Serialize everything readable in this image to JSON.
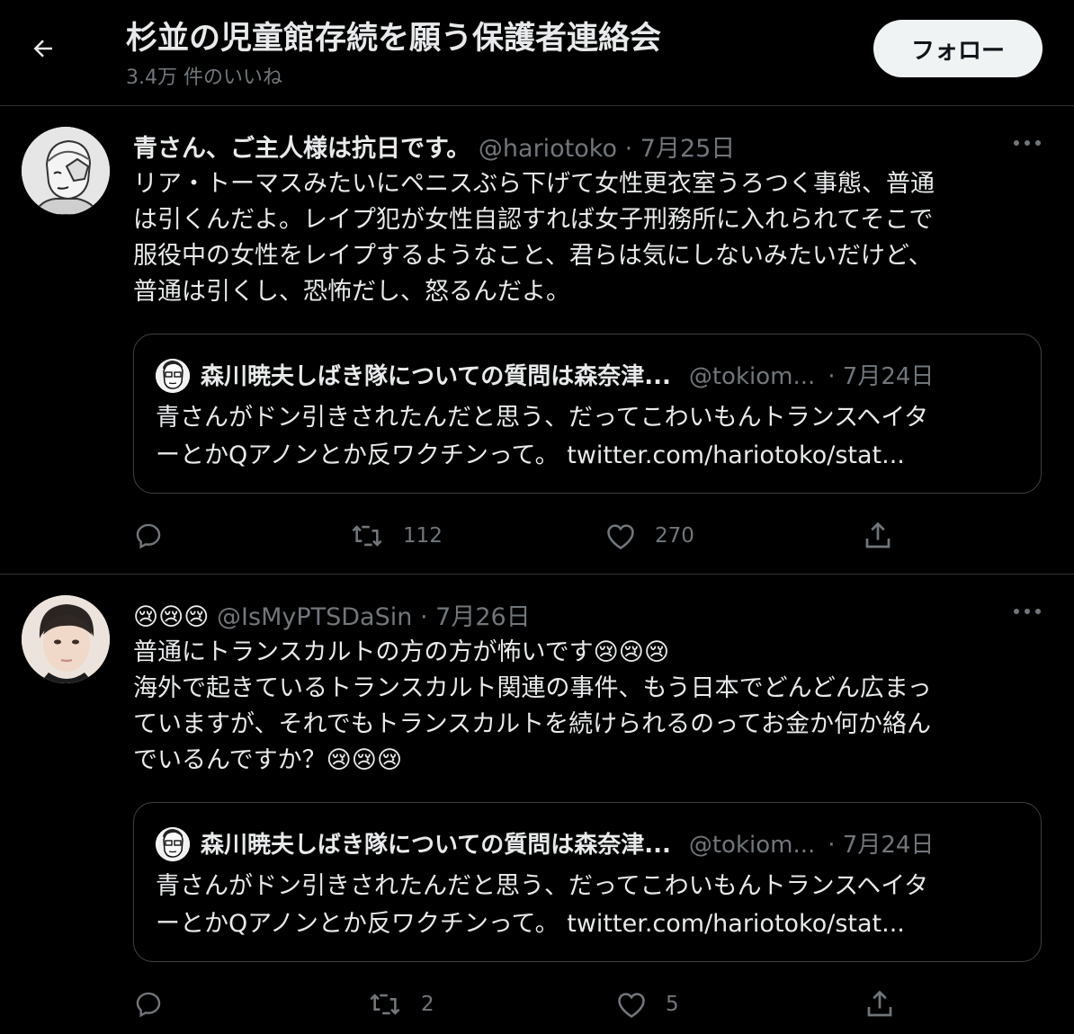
{
  "header": {
    "title": "杉並の児童館存続を願う保護者連絡会",
    "subtitle": "3.4万 件のいいね",
    "follow_label": "フォロー"
  },
  "tweets": [
    {
      "name": "青さん、ご主人様は抗日です。",
      "handle": "@hariotoko",
      "dot": "·",
      "date": "7月25日",
      "lines": [
        "リア・トーマスみたいにペニスぶら下げて女性更衣室うろつく事態、普通",
        "は引くんだよ。レイプ犯が女性自認すれば女子刑務所に入れられてそこで",
        "服役中の女性をレイプするようなこと、君らは気にしないみたいだけど、",
        "普通は引くし、恐怖だし、怒るんだよ。"
      ],
      "quote": {
        "name": "森川暁夫しばき隊についての質問は森奈津...",
        "handle": "@tokiom...",
        "date": "· 7月24日",
        "lines": [
          "青さんがドン引きされたんだと思う、だってこわいもんトランスヘイタ",
          "ーとかQアノンとか反ワクチンって。 twitter.com/hariotoko/stat..."
        ]
      },
      "stats": {
        "retweets": "112",
        "likes": "270"
      }
    },
    {
      "name": "😢😢😢",
      "handle": "@IsMyPTSDaSin",
      "dot": "·",
      "date": "7月26日",
      "lines": [
        "普通にトランスカルトの方の方が怖いです😢😢😢",
        "海外で起きているトランスカルト関連の事件、もう日本でどんどん広まっ",
        "ていますが、それでもトランスカルトを続けられるのってお金か何か絡ん",
        "でいるんですか？😢😢😢"
      ],
      "quote": {
        "name": "森川暁夫しばき隊についての質問は森奈津...",
        "handle": "@tokiom...",
        "date": "· 7月24日",
        "lines": [
          "青さんがドン引きされたんだと思う、だってこわいもんトランスヘイタ",
          "ーとかQアノンとか反ワクチンって。 twitter.com/hariotoko/stat..."
        ]
      },
      "stats": {
        "retweets": "2",
        "likes": "5"
      }
    }
  ],
  "icons": {
    "back": "arrow-left-icon",
    "more": "more-horizontal-icon",
    "reply": "reply-icon",
    "retweet": "retweet-icon",
    "like": "heart-icon",
    "share": "share-icon"
  },
  "colors": {
    "background": "#000000",
    "text": "#e7e9ea",
    "secondary": "#71767b",
    "divider": "#2f3336",
    "follow_bg": "#eff3f4"
  }
}
